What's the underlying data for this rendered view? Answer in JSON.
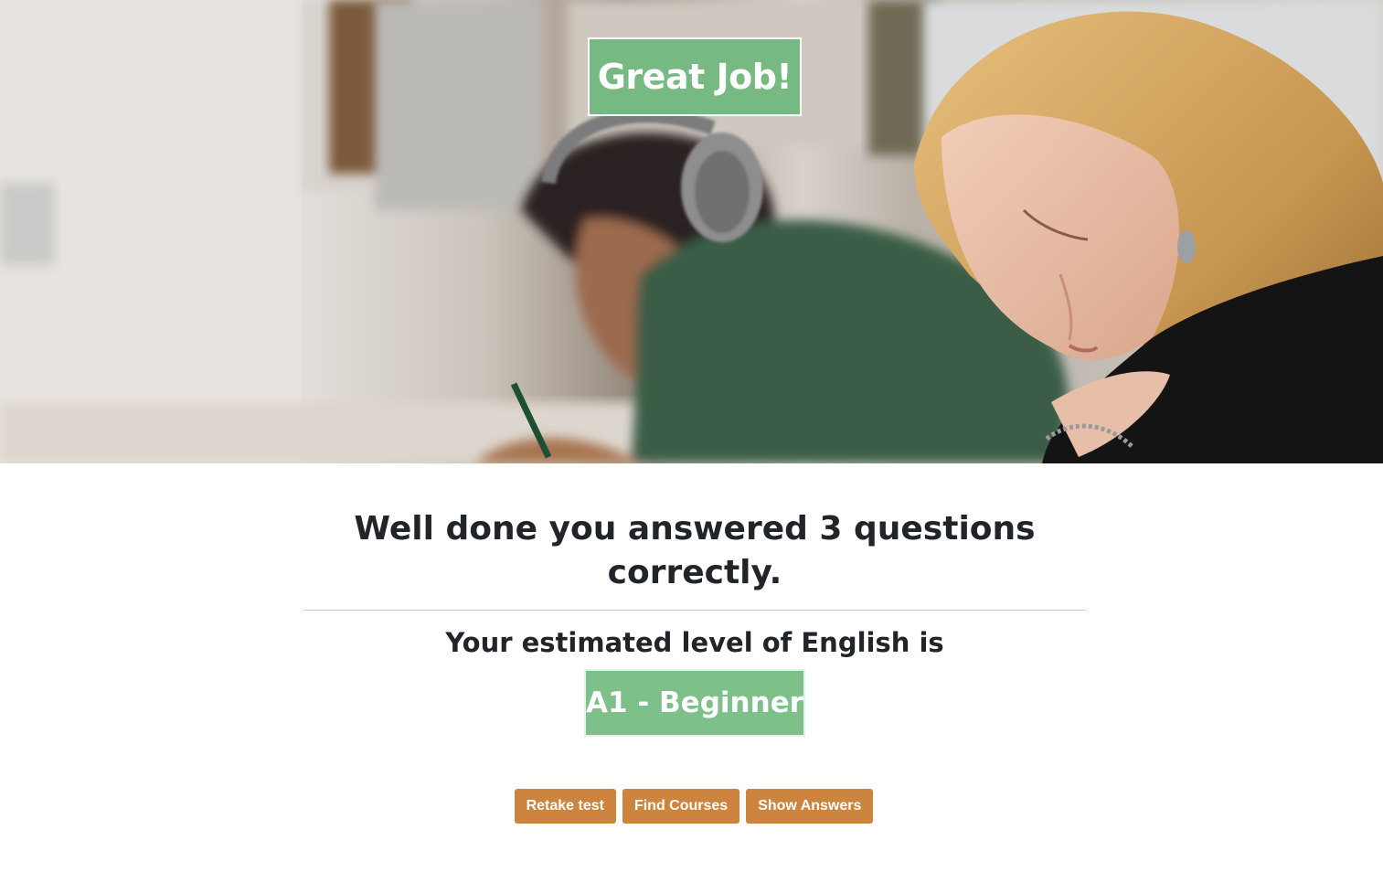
{
  "hero": {
    "badge_text": "Great Job!",
    "badge_color": "#76b983",
    "photo": "students-taking-test-photo"
  },
  "result": {
    "headline": "Well done you answered 3 questions correctly.",
    "level_intro": "Your estimated level of English is",
    "level": "A1 - Beginner",
    "level_color": "#7dc08a"
  },
  "actions": {
    "retake_label": "Retake test",
    "find_courses_label": "Find Courses",
    "show_answers_label": "Show Answers",
    "button_color": "#cd843e"
  }
}
